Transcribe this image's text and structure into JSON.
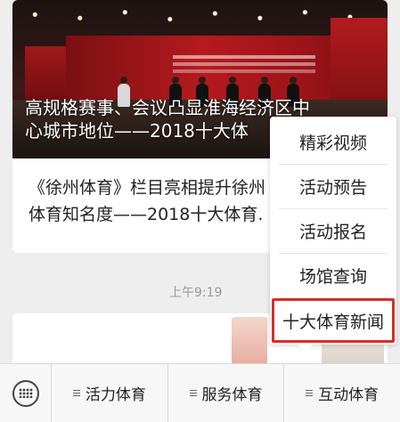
{
  "article": {
    "headline_line1": "高规格赛事、会议凸显淮海经济区中",
    "headline_line2": "心城市地位——2018十大体",
    "subtitle_line1": "《徐州体育》栏目亮相提升徐州",
    "subtitle_line2": "体育知名度——2018十大体育."
  },
  "timestamp": "上午9:19",
  "popup_menu": {
    "items": [
      {
        "label": "精彩视频"
      },
      {
        "label": "活动预告"
      },
      {
        "label": "活动报名"
      },
      {
        "label": "场馆查询"
      },
      {
        "label": "十大体育新闻"
      }
    ],
    "highlighted_index": 4,
    "highlight_color": "#d0312d"
  },
  "bottom_menu": {
    "keyboard_icon": "keyboard-icon",
    "tabs": [
      {
        "label": "活力体育"
      },
      {
        "label": "服务体育"
      },
      {
        "label": "互动体育"
      }
    ]
  }
}
